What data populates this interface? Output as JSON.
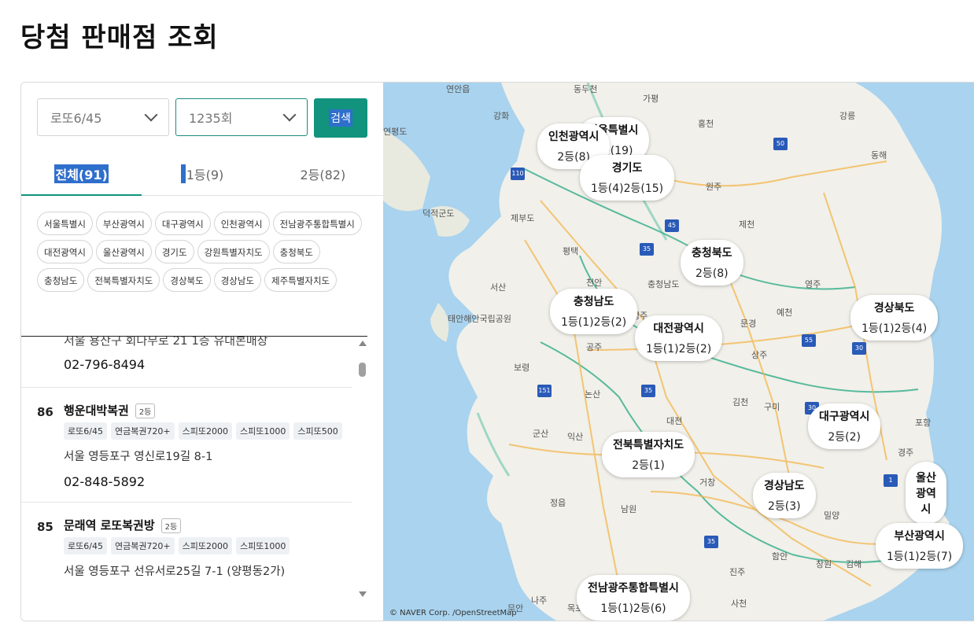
{
  "page": {
    "title": "당첨 판매점 조회"
  },
  "filters": {
    "game_select": "로또6/45",
    "round_select": "1235회",
    "search_label": "검색"
  },
  "tabs": [
    {
      "label": "전체(91)",
      "active": true
    },
    {
      "label": "1등(9)",
      "active": false
    },
    {
      "label": "2등(82)",
      "active": false
    }
  ],
  "regions": [
    "서울특별시",
    "부산광역시",
    "대구광역시",
    "인천광역시",
    "전남광주통합특별시",
    "대전광역시",
    "울산광역시",
    "경기도",
    "강원특별자치도",
    "충청북도",
    "충청남도",
    "전북특별자치도",
    "경상북도",
    "경상남도",
    "제주특별자치도"
  ],
  "list": {
    "partial": {
      "address": "서울 용산구 회나무로 21 1층 유대본매장",
      "phone": "02-796-8494"
    },
    "items": [
      {
        "rank": "86",
        "name": "행운대박복권",
        "grade": "2등",
        "tags": [
          "로또6/45",
          "연금복권720+",
          "스피또2000",
          "스피또1000",
          "스피또500"
        ],
        "address": "서울 영등포구 영신로19길 8-1",
        "phone": "02-848-5892"
      },
      {
        "rank": "85",
        "name": "문래역 로또복권방",
        "grade": "2등",
        "tags": [
          "로또6/45",
          "연금복권720+",
          "스피또2000",
          "스피또1000"
        ],
        "address": "서울 영등포구 선유서로25길 7-1 (양평동2가)",
        "phone": ""
      }
    ]
  },
  "map": {
    "credit": "© NAVER Corp. /OpenStreetMap",
    "colors": {
      "sea": "#a9d3ee",
      "land": "#f1f0ea",
      "accent": "#11937e",
      "road": "#f3b64b",
      "boundary": "#3bb08f"
    },
    "markers": [
      {
        "title": "서울특별시",
        "value": "2등(19)"
      },
      {
        "title": "인천광역시",
        "value": "2등(8)"
      },
      {
        "title": "경기도",
        "value": "1등(4)2등(15)"
      },
      {
        "title": "충청북도",
        "value": "2등(8)"
      },
      {
        "title": "충청남도",
        "value": "1등(1)2등(2)"
      },
      {
        "title": "대전광역시",
        "value": "1등(1)2등(2)"
      },
      {
        "title": "경상북도",
        "value": "1등(1)2등(4)"
      },
      {
        "title": "대구광역시",
        "value": "2등(2)"
      },
      {
        "title": "전북특별자치도",
        "value": "2등(1)"
      },
      {
        "title": "경상남도",
        "value": "2등(3)"
      },
      {
        "title": "울산광역시",
        "value": ""
      },
      {
        "title": "부산광역시",
        "value": "1등(1)2등(7)"
      },
      {
        "title": "전남광주통합특별시",
        "value": "1등(1)2등(6)"
      }
    ],
    "places": [
      "연안읍",
      "동두천",
      "가평",
      "강화",
      "홍천",
      "강릉",
      "연평도",
      "동해",
      "원주",
      "덕적군도",
      "제부도",
      "제천",
      "평택",
      "서산",
      "천안",
      "충청남도",
      "청주",
      "영주",
      "예천",
      "태안해안국립공원",
      "문경",
      "공주",
      "상주",
      "보령",
      "논산",
      "김천",
      "구미",
      "군산",
      "익산",
      "대전",
      "포항",
      "경주",
      "울산",
      "거창",
      "정읍",
      "남원",
      "함안",
      "창원",
      "김해",
      "목포",
      "사천",
      "진주",
      "무안",
      "나주",
      "밀양",
      "전남광주"
    ]
  }
}
